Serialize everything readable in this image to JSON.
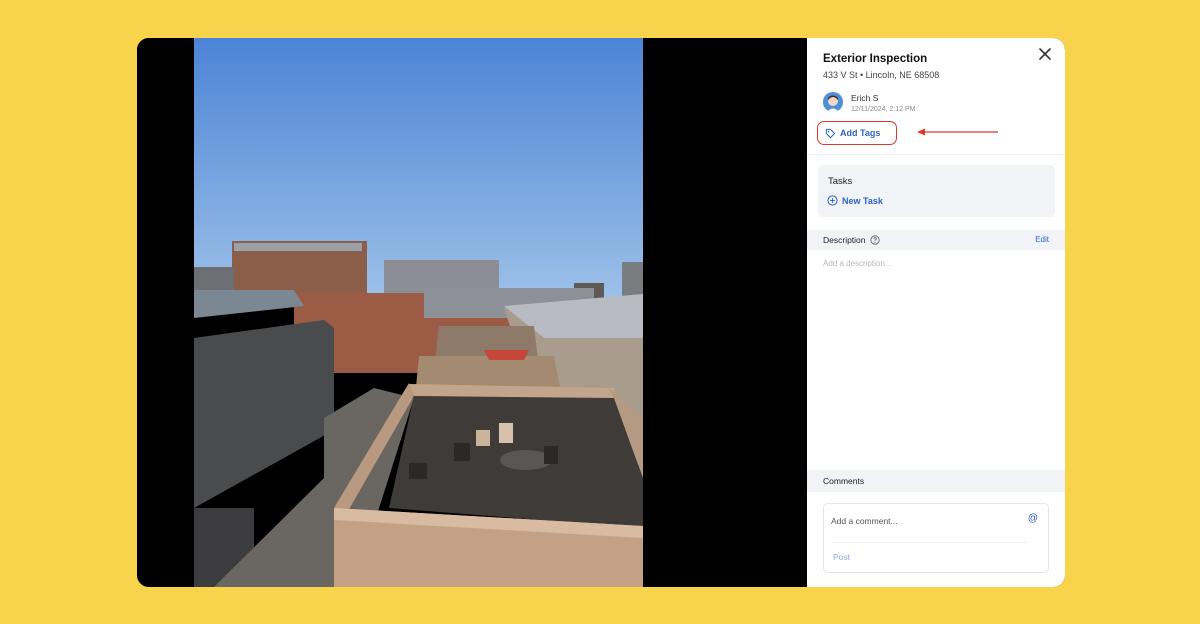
{
  "inspection": {
    "title": "Exterior Inspection",
    "address": "433 V St • Lincoln, NE 68508"
  },
  "author": {
    "name": "Erich S",
    "timestamp": "12/11/2024, 2:12 PM"
  },
  "tags": {
    "add_label": "Add Tags"
  },
  "tasks": {
    "title": "Tasks",
    "new_task_label": "New Task"
  },
  "description": {
    "title": "Description",
    "edit_label": "Edit",
    "placeholder": "Add a description..."
  },
  "comments": {
    "title": "Comments",
    "placeholder": "Add a comment...",
    "mention_symbol": "@",
    "post_label": "Post"
  },
  "icons": {
    "close": "close-icon",
    "tag": "tag-icon",
    "plus_circle": "plus-circle-icon",
    "help": "help-icon",
    "at": "at-icon"
  },
  "colors": {
    "background": "#F7D44C",
    "accent": "#2F63C4",
    "highlight": "#D9392B",
    "panel_section": "#F1F3F6"
  }
}
